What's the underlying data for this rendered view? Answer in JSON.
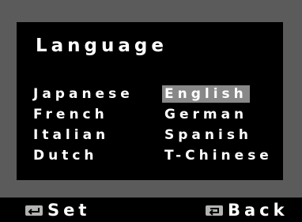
{
  "menu": {
    "title": "Language",
    "selected": "English",
    "languages": [
      "Japanese",
      "English",
      "French",
      "German",
      "Italian",
      "Spanish",
      "Dutch",
      "T-Chinese"
    ]
  },
  "footer": {
    "set_label": "Set",
    "set_icon": "enter-key-icon",
    "back_label": "Back",
    "back_icon": "return-key-icon"
  },
  "colors": {
    "bezel": "#5b5b5b",
    "screen": "#000000",
    "highlight": "#888888",
    "text": "#ffffff"
  }
}
